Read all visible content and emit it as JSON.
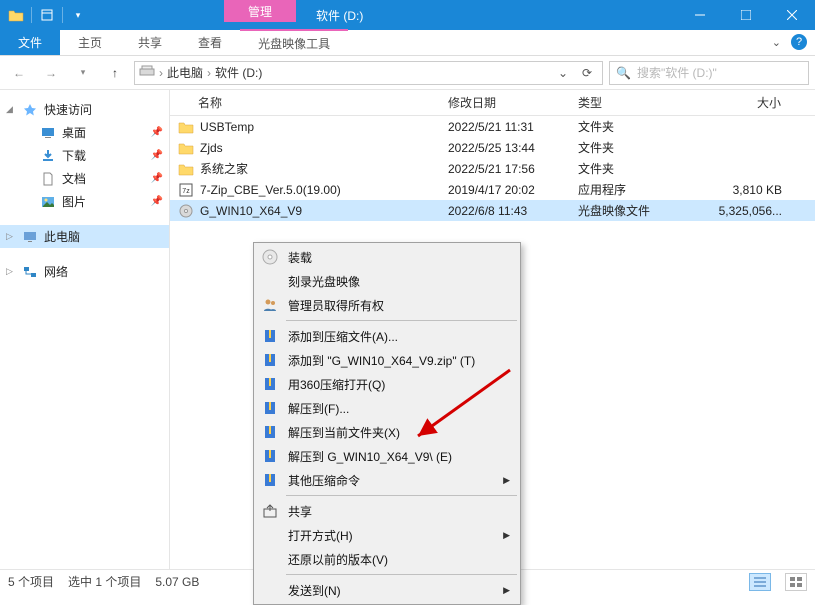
{
  "window": {
    "title": "软件 (D:)",
    "context_tab": "管理"
  },
  "ribbon": {
    "file": "文件",
    "tabs": [
      "主页",
      "共享",
      "查看"
    ],
    "context_tab": "光盘映像工具"
  },
  "address": {
    "segments": [
      "此电脑",
      "软件 (D:)"
    ],
    "search_placeholder": "搜索\"软件 (D:)\""
  },
  "nav": {
    "quick_access": "快速访问",
    "quick_items": [
      "桌面",
      "下载",
      "文档",
      "图片"
    ],
    "this_pc": "此电脑",
    "network": "网络"
  },
  "columns": {
    "name": "名称",
    "date": "修改日期",
    "type": "类型",
    "size": "大小"
  },
  "files": [
    {
      "icon": "folder",
      "name": "USBTemp",
      "date": "2022/5/21 11:31",
      "type": "文件夹",
      "size": ""
    },
    {
      "icon": "folder",
      "name": "Zjds",
      "date": "2022/5/25 13:44",
      "type": "文件夹",
      "size": ""
    },
    {
      "icon": "folder",
      "name": "系统之家",
      "date": "2022/5/21 17:56",
      "type": "文件夹",
      "size": ""
    },
    {
      "icon": "7z",
      "name": "7-Zip_CBE_Ver.5.0(19.00)",
      "date": "2019/4/17 20:02",
      "type": "应用程序",
      "size": "3,810 KB"
    },
    {
      "icon": "iso",
      "name": "G_WIN10_X64_V9",
      "date": "2022/6/8 11:43",
      "type": "光盘映像文件",
      "size": "5,325,056...",
      "selected": true
    }
  ],
  "status": {
    "count": "5 个项目",
    "selection": "选中 1 个项目",
    "size": "5.07 GB"
  },
  "context_menu": [
    {
      "icon": "disc",
      "label": "装载"
    },
    {
      "label": "刻录光盘映像"
    },
    {
      "icon": "users",
      "label": "管理员取得所有权"
    },
    {
      "sep": true
    },
    {
      "icon": "zip",
      "label": "添加到压缩文件(A)..."
    },
    {
      "icon": "zip",
      "label": "添加到 \"G_WIN10_X64_V9.zip\" (T)"
    },
    {
      "icon": "zip",
      "label": "用360压缩打开(Q)"
    },
    {
      "icon": "zip",
      "label": "解压到(F)..."
    },
    {
      "icon": "zip",
      "label": "解压到当前文件夹(X)"
    },
    {
      "icon": "zip",
      "label": "解压到 G_WIN10_X64_V9\\ (E)"
    },
    {
      "icon": "zip",
      "label": "其他压缩命令",
      "submenu": true
    },
    {
      "sep": true
    },
    {
      "icon": "share",
      "label": "共享"
    },
    {
      "label": "打开方式(H)",
      "submenu": true
    },
    {
      "label": "还原以前的版本(V)"
    },
    {
      "sep": true
    },
    {
      "label": "发送到(N)",
      "submenu": true
    }
  ]
}
